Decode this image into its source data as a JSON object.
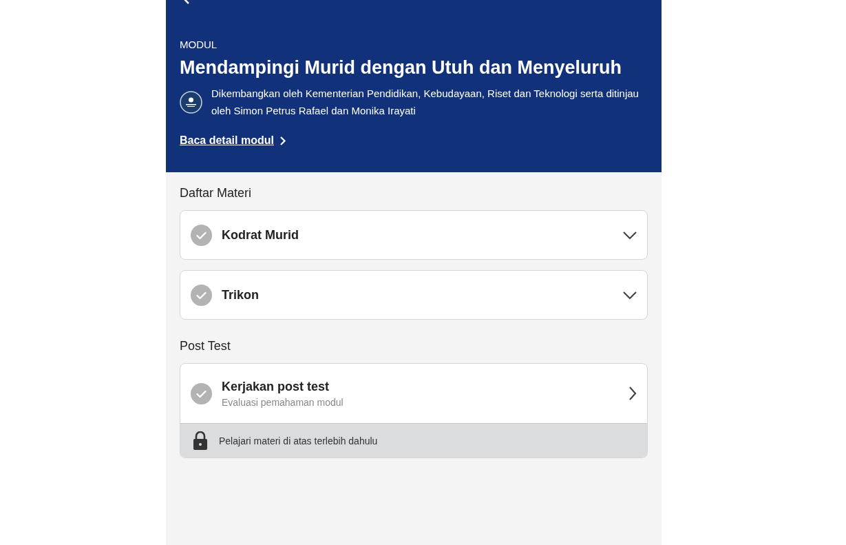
{
  "header": {
    "eyebrow": "MODUL",
    "title": "Mendampingi Murid dengan Utuh dan Menyeluruh",
    "credit": "Dikembangkan oleh Kementerian Pendidikan, Kebudayaan, Riset dan Teknologi serta ditinjau oleh Simon Petrus Rafael dan Monika Irayati",
    "detail_link": "Baca detail modul"
  },
  "materials": {
    "heading": "Daftar Materi",
    "items": [
      {
        "title": "Kodrat Murid",
        "completed": false,
        "expanded": false
      },
      {
        "title": "Trikon",
        "completed": false,
        "expanded": false
      }
    ]
  },
  "post_test": {
    "heading": "Post Test",
    "title": "Kerjakan post test",
    "subtitle": "Evaluasi pemahaman modul",
    "completed": false,
    "locked": true,
    "lock_note": "Pelajari materi di atas terlebih dahulu"
  }
}
